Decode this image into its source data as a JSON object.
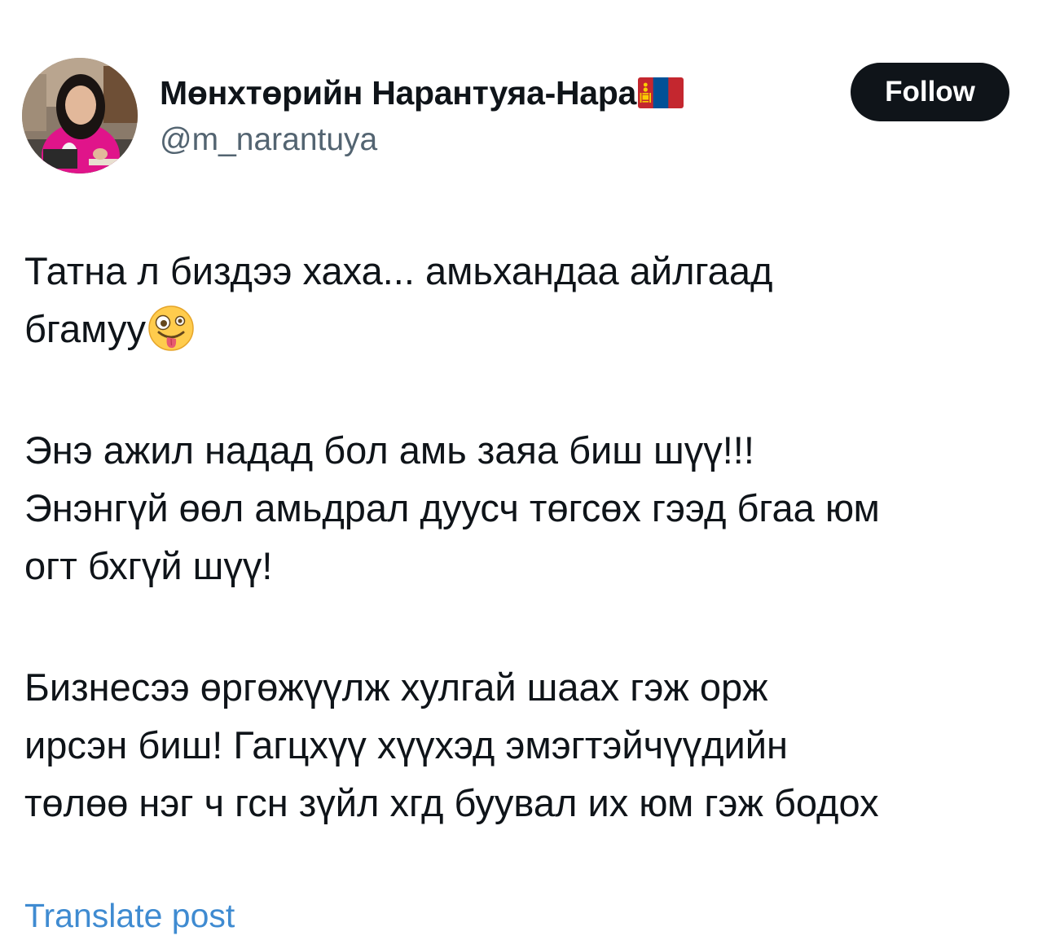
{
  "author": {
    "display_name": "Мөнхтөрийн Нарантуяа-Нара",
    "flag_icon": "mongolia-flag-icon",
    "handle": "@m_narantuya",
    "avatar_icon": "profile-photo"
  },
  "follow_button": {
    "label": "Follow"
  },
  "post": {
    "paragraph_1": {
      "line_1": "Татна л биздээ хаха... амьхандаа айлгаад",
      "line_2": "бгамуу",
      "emoji": "zany-face-emoji"
    },
    "paragraph_2": {
      "line_1": "Энэ ажил надад бол амь заяа биш шүү!!!",
      "line_2": "Энэнгүй өөл амьдрал дуусч төгсөх гээд бгаа юм",
      "line_3": "огт бхгүй шүү!"
    },
    "paragraph_3": {
      "line_1": "Бизнесээ өргөжүүлж хулгай шаах гэж орж",
      "line_2": "ирсэн биш! Гагцхүү хүүхэд эмэгтэйчүүдийн",
      "line_3": "төлөө нэг ч гсн зүйл хгд буувал их юм гэж бодох"
    }
  },
  "translate": {
    "label": "Translate post"
  },
  "colors": {
    "text_primary": "#0f1419",
    "text_secondary": "#536471",
    "link": "#3f8bd1",
    "follow_bg": "#0f1419",
    "follow_text": "#ffffff",
    "avatar_jacket": "#e0148a"
  }
}
